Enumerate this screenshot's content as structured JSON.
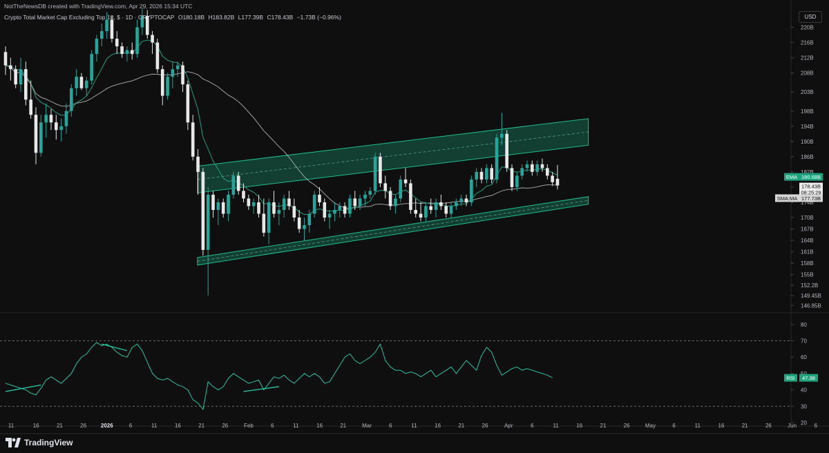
{
  "header": {
    "credit": "NotTheNewsDB created with TradingView.com, Apr 29, 2026 15:34 UTC",
    "symbol": "Crypto Total Market Cap Excluding Top 10, $ · 1D · CRYPTOCAP",
    "open": "O180.18B",
    "high": "H183.82B",
    "low": "L177.39B",
    "close": "C178.43B",
    "change": "−1.73B (−0.96%)",
    "currency": "USD"
  },
  "branding": {
    "name": "TradingView"
  },
  "colors": {
    "background": "#0f0f0f",
    "up": "#26a69a",
    "down": "#e8e8e8",
    "channel": "#1fbf92",
    "ema": "#1f9e80",
    "sma": "#cccccc",
    "rsi": "#27c2a0"
  },
  "chart_data": [
    {
      "type": "candlestick",
      "title": "Crypto Total Market Cap Excluding Top 10, $ · 1D · CRYPTOCAP",
      "units": "USD billions",
      "ylim": [
        145.5,
        225
      ],
      "yticks": [
        "220B",
        "216B",
        "212B",
        "208B",
        "203B",
        "198B",
        "194B",
        "190B",
        "186B",
        "182B",
        "178B",
        "174B",
        "170B",
        "167B",
        "164B",
        "161B",
        "158B",
        "155B",
        "152.2B",
        "149.45B",
        "146.85B"
      ],
      "xticks": [
        "11",
        "16",
        "21",
        "26",
        "2026",
        "6",
        "11",
        "16",
        "21",
        "26",
        "Feb",
        "6",
        "11",
        "16",
        "21",
        "Mar",
        "6",
        "11",
        "16",
        "21",
        "26",
        "Apr",
        "6",
        "11",
        "16",
        "21",
        "26",
        "May",
        "6",
        "11",
        "16",
        "21",
        "26",
        "Jun",
        "6"
      ],
      "last_close": 178.43,
      "countdown": "08:25:29",
      "ema_value": "180.68B",
      "sma_value": "177.73B",
      "indicator_labels": {
        "ema": "EMA",
        "sma": "SMA:MA"
      },
      "ohlc": [
        [
          213.5,
          215,
          207.5,
          210
        ],
        [
          210,
          212,
          206,
          209
        ],
        [
          209,
          210,
          204,
          205
        ],
        [
          205,
          212,
          203,
          209
        ],
        [
          209,
          211,
          199.5,
          201
        ],
        [
          201,
          206,
          196,
          197
        ],
        [
          197,
          199,
          184,
          187
        ],
        [
          187,
          197,
          186,
          195
        ],
        [
          195,
          200,
          191,
          197
        ],
        [
          197,
          198.5,
          193,
          195
        ],
        [
          195,
          197,
          190.5,
          193
        ],
        [
          193,
          196,
          190,
          194
        ],
        [
          194,
          200,
          192,
          198
        ],
        [
          198,
          205,
          196.5,
          204
        ],
        [
          204,
          209,
          202,
          207
        ],
        [
          207,
          208,
          203.5,
          204
        ],
        [
          204,
          207,
          202,
          206
        ],
        [
          206,
          214,
          205,
          213
        ],
        [
          213,
          218,
          211,
          217
        ],
        [
          217,
          221,
          215,
          219
        ],
        [
          219,
          224,
          217,
          222
        ],
        [
          222,
          223,
          216,
          217
        ],
        [
          217,
          219,
          213,
          215
        ],
        [
          215,
          216,
          212,
          213
        ],
        [
          213,
          215,
          211,
          214
        ],
        [
          214,
          216,
          211.5,
          213
        ],
        [
          213,
          222,
          212,
          220
        ],
        [
          220,
          225,
          218,
          223
        ],
        [
          223,
          224.5,
          217,
          218
        ],
        [
          218,
          219,
          213,
          216
        ],
        [
          216,
          217,
          208,
          209
        ],
        [
          209,
          210,
          199.5,
          202
        ],
        [
          202,
          208,
          201,
          207
        ],
        [
          207,
          211,
          204,
          209
        ],
        [
          209,
          211,
          207,
          210
        ],
        [
          210,
          211,
          203,
          205
        ],
        [
          205,
          206,
          193,
          195
        ],
        [
          195,
          197,
          185,
          186
        ],
        [
          186,
          188,
          176,
          182
        ],
        [
          182,
          183,
          160,
          161.5
        ],
        [
          161.5,
          178,
          149.5,
          176
        ],
        [
          176,
          177,
          170,
          172
        ],
        [
          172,
          175,
          168,
          174
        ],
        [
          174,
          175,
          170,
          171
        ],
        [
          171,
          177,
          169,
          176
        ],
        [
          176,
          182,
          175,
          181
        ],
        [
          181,
          182,
          176,
          177
        ],
        [
          177,
          179,
          174,
          175
        ],
        [
          175,
          176,
          172,
          173
        ],
        [
          173,
          175,
          171,
          174
        ],
        [
          174,
          176,
          170,
          171
        ],
        [
          171,
          175,
          165,
          166
        ],
        [
          166,
          175,
          163,
          174
        ],
        [
          174,
          177,
          170,
          171
        ],
        [
          171,
          174,
          168,
          172
        ],
        [
          172,
          176,
          170,
          175
        ],
        [
          175,
          177,
          172,
          173
        ],
        [
          173,
          175,
          169,
          170
        ],
        [
          170,
          172,
          166,
          167
        ],
        [
          167,
          170,
          164,
          168
        ],
        [
          168,
          172,
          166,
          171
        ],
        [
          171,
          177,
          170,
          176
        ],
        [
          176,
          178,
          173,
          174
        ],
        [
          174,
          175,
          169,
          170
        ],
        [
          170,
          172,
          167,
          171
        ],
        [
          171,
          174,
          169,
          172
        ],
        [
          172,
          174,
          170,
          173
        ],
        [
          173,
          174,
          170,
          171
        ],
        [
          171,
          176,
          170,
          175
        ],
        [
          175,
          177,
          172,
          173
        ],
        [
          173,
          176,
          172,
          175
        ],
        [
          175,
          177,
          173,
          176
        ],
        [
          176,
          178,
          175,
          177
        ],
        [
          177,
          187,
          176,
          186
        ],
        [
          186,
          187,
          178,
          179
        ],
        [
          179,
          181,
          175,
          177
        ],
        [
          177,
          178,
          172,
          173
        ],
        [
          173,
          176,
          171,
          175
        ],
        [
          175,
          181,
          174,
          180
        ],
        [
          180,
          183,
          178,
          179
        ],
        [
          179,
          180,
          171,
          172
        ],
        [
          172,
          175,
          170,
          171
        ],
        [
          171,
          174,
          169,
          170
        ],
        [
          170,
          174,
          169,
          173
        ],
        [
          173,
          175,
          171,
          172
        ],
        [
          172,
          175,
          170,
          174
        ],
        [
          174,
          176,
          172,
          173
        ],
        [
          173,
          174,
          170,
          171
        ],
        [
          171,
          174,
          170,
          173
        ],
        [
          173,
          175,
          172,
          174
        ],
        [
          174,
          176,
          173,
          175
        ],
        [
          175,
          176,
          173,
          174
        ],
        [
          174,
          181,
          173,
          180
        ],
        [
          180,
          183,
          178,
          182
        ],
        [
          182,
          183,
          179,
          180
        ],
        [
          180,
          184,
          179,
          183
        ],
        [
          183,
          184,
          179,
          180
        ],
        [
          180,
          192,
          179,
          191
        ],
        [
          191,
          197.5,
          189,
          192
        ],
        [
          192,
          193,
          182,
          183
        ],
        [
          183,
          184,
          177,
          178
        ],
        [
          178,
          182,
          177,
          181
        ],
        [
          181,
          184,
          180,
          183
        ],
        [
          183,
          185,
          182,
          184
        ],
        [
          184,
          185,
          181,
          182
        ],
        [
          182,
          185,
          181,
          184
        ],
        [
          184,
          185.5,
          182,
          183
        ],
        [
          183,
          184,
          180,
          181
        ],
        [
          181,
          182,
          178.3,
          179.3
        ],
        [
          180.18,
          183.82,
          177.39,
          178.43
        ]
      ],
      "channel_upper": {
        "start": [
          39,
          183.5
        ],
        "end": [
          114,
          196
        ],
        "lower_start": [
          39,
          176.5
        ],
        "lower_end": [
          114,
          189
        ]
      },
      "channel_lower": {
        "start": [
          39,
          159.5
        ],
        "end": [
          114,
          175.5
        ],
        "lower_start": [
          39,
          157.5
        ],
        "lower_end": [
          114,
          173.5
        ]
      }
    },
    {
      "type": "line",
      "title": "RSI",
      "value_label": "47.38",
      "ylim": [
        20,
        85
      ],
      "yticks": [
        "80",
        "70",
        "60",
        "50",
        "40",
        "30",
        "20"
      ],
      "levels": [
        70,
        30
      ],
      "values": [
        44,
        43,
        42,
        41,
        40,
        38,
        37,
        41,
        46,
        48,
        46,
        44,
        47,
        50,
        56,
        60,
        62,
        66,
        69,
        67,
        68,
        66,
        63,
        61,
        60,
        66,
        68,
        64,
        57,
        50,
        47,
        46,
        47,
        45,
        43,
        42,
        40,
        34,
        32,
        28,
        45,
        42,
        40,
        42,
        47,
        50,
        48,
        46,
        44,
        45,
        46,
        40,
        44,
        48,
        47,
        49,
        46,
        44,
        47,
        50,
        48,
        50,
        48,
        44,
        45,
        50,
        55,
        60,
        62,
        58,
        56,
        58,
        60,
        63,
        68,
        58,
        54,
        52,
        52,
        50,
        51,
        50,
        48,
        50,
        52,
        48,
        50,
        52,
        54,
        50,
        54,
        58,
        55,
        52,
        61,
        66,
        63,
        55,
        49,
        51,
        53,
        54,
        52,
        53,
        52,
        51,
        50,
        49,
        47.38
      ],
      "divergence_lines": [
        [
          [
            0,
            39
          ],
          [
            7,
            43
          ]
        ],
        [
          [
            19,
            68
          ],
          [
            24,
            64
          ]
        ],
        [
          [
            47,
            39
          ],
          [
            54,
            42
          ]
        ]
      ]
    }
  ]
}
